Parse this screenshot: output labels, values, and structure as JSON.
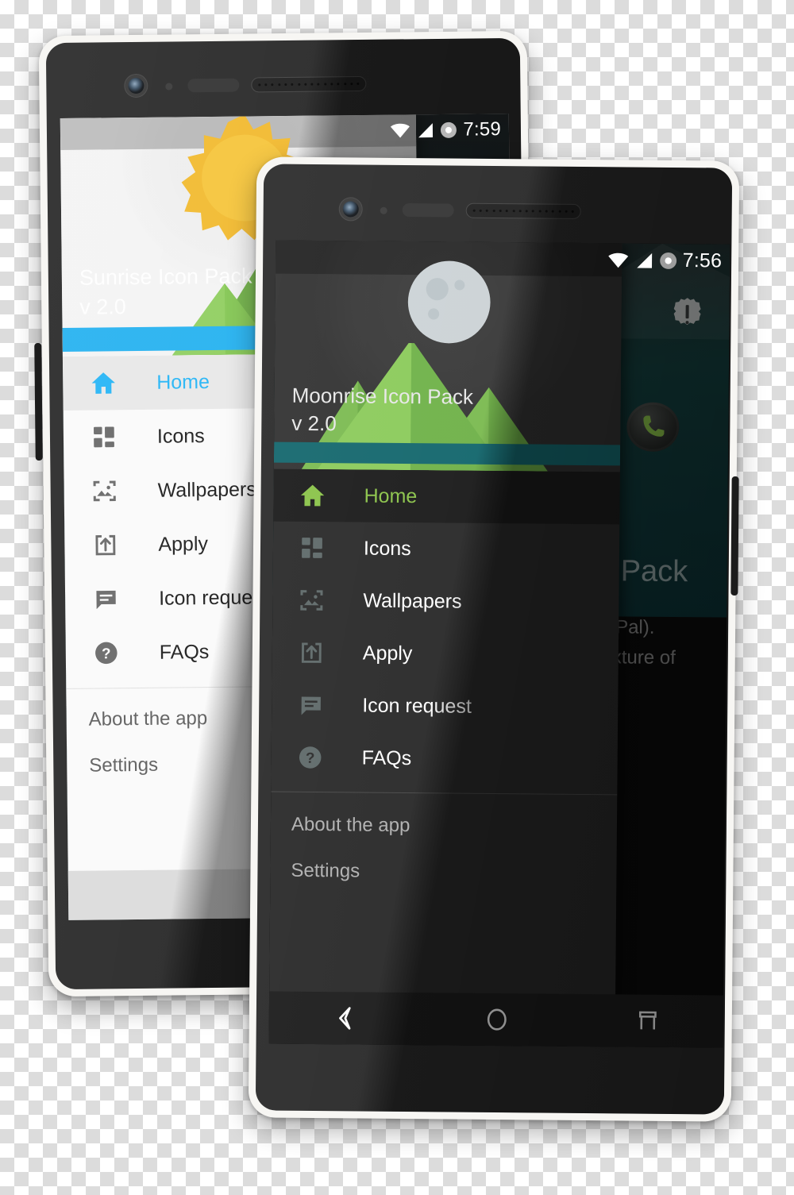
{
  "scene": {
    "description": "Two Android phone mockups showing an icon pack app navigation drawer, light theme and dark theme",
    "background": "transparency-checkerboard"
  },
  "colors": {
    "light_accent": "#29b6f6",
    "dark_accent": "#8bc34a",
    "light_drawer_bg": "#fafafa",
    "dark_drawer_bg": "#2b2b2b",
    "light_banner_bg": "#f2f2f2",
    "dark_banner_bg": "#333333",
    "light_water": "#29b6f6",
    "dark_water": "#1b6f72",
    "mountain_light": "#8bc34a",
    "mountain_dark": "#5d9e3f",
    "sun": "#f5c33b",
    "moon": "#ccd3d6"
  },
  "light_phone": {
    "name": "Sunrise Icon Pack phone",
    "status_bar": {
      "time": "7:59",
      "icons": [
        "wifi-icon",
        "signal-icon",
        "alarm-icon"
      ]
    },
    "banner": {
      "title": "Sunrise Icon Pack",
      "version": "v 2.0",
      "celestial": "sun-icon"
    },
    "nav_items": [
      {
        "label": "Home",
        "icon": "home-icon",
        "selected": true
      },
      {
        "label": "Icons",
        "icon": "grid-icon",
        "selected": false
      },
      {
        "label": "Wallpapers",
        "icon": "image-icon",
        "selected": false
      },
      {
        "label": "Apply",
        "icon": "apply-upload-icon",
        "selected": false
      },
      {
        "label": "Icon request",
        "icon": "chat-bubble-icon",
        "selected": false
      },
      {
        "label": "FAQs",
        "icon": "help-circle-icon",
        "selected": false
      }
    ],
    "secondary_items": [
      {
        "label": "About the app"
      },
      {
        "label": "Settings"
      }
    ],
    "nav_bar": {
      "buttons": [
        {
          "name": "back-button",
          "icon": "back-chevron-icon"
        }
      ]
    }
  },
  "dark_phone": {
    "name": "Moonrise Icon Pack phone",
    "status_bar": {
      "time": "7:56",
      "icons": [
        "wifi-icon",
        "signal-icon",
        "alarm-icon"
      ]
    },
    "banner": {
      "title": "Moonrise Icon Pack",
      "version": "v 2.0",
      "celestial": "moon-icon"
    },
    "nav_items": [
      {
        "label": "Home",
        "icon": "home-icon",
        "selected": true
      },
      {
        "label": "Icons",
        "icon": "grid-icon",
        "selected": false
      },
      {
        "label": "Wallpapers",
        "icon": "image-icon",
        "selected": false
      },
      {
        "label": "Apply",
        "icon": "apply-upload-icon",
        "selected": false
      },
      {
        "label": "Icon request",
        "icon": "chat-bubble-icon",
        "selected": false
      },
      {
        "label": "FAQs",
        "icon": "help-circle-icon",
        "selected": false
      }
    ],
    "secondary_items": [
      {
        "label": "About the app"
      },
      {
        "label": "Settings"
      }
    ],
    "nav_bar": {
      "buttons": [
        {
          "name": "back-button",
          "icon": "back-chevron-icon"
        },
        {
          "name": "home-button",
          "icon": "home-circle-icon"
        },
        {
          "name": "recents-button",
          "icon": "recents-square-icon"
        }
      ]
    },
    "background_content": {
      "partial_title": "Pack",
      "partial_line_1": "Pal).",
      "partial_line_2": "xture of",
      "icons": [
        "warning-badge-icon",
        "phone-app-icon"
      ]
    }
  }
}
